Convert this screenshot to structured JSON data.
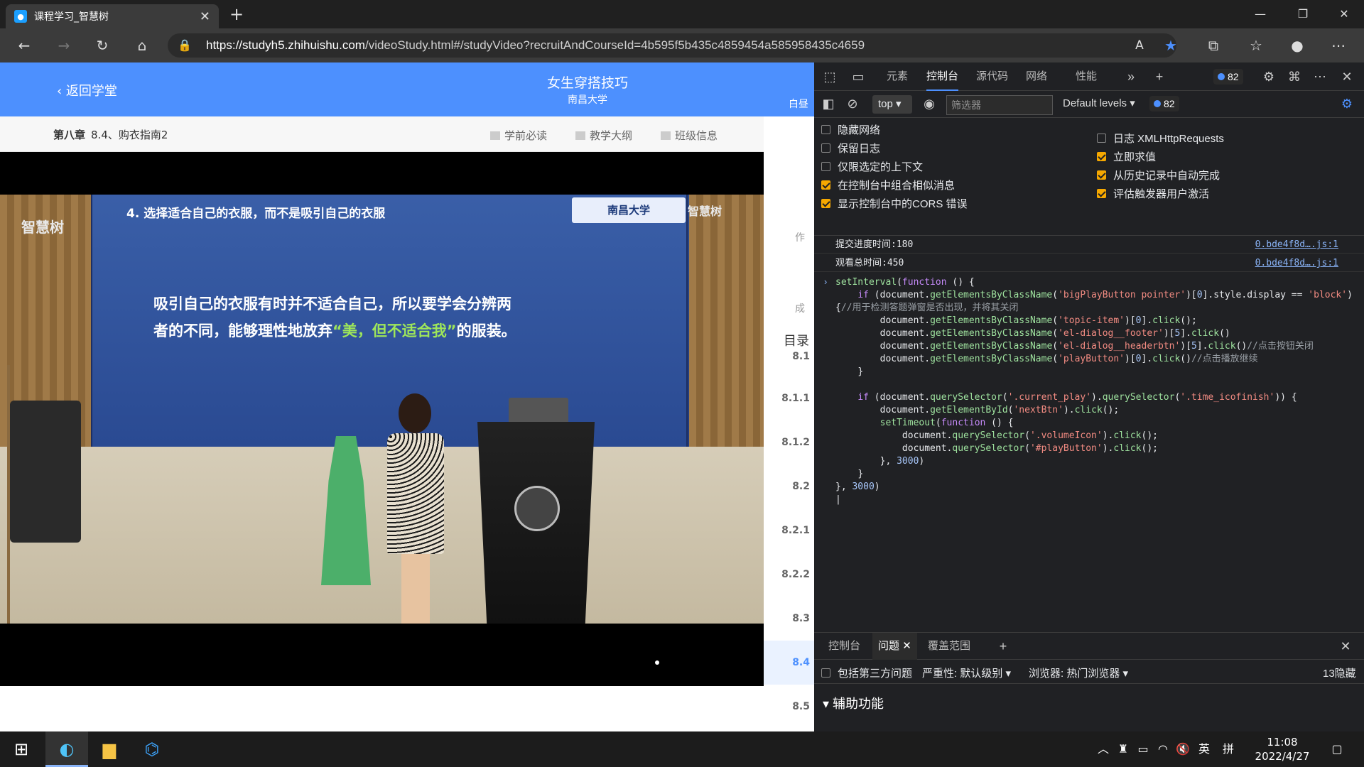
{
  "browser": {
    "tab_title": "课程学习_智慧树",
    "url_host": "https://studyh5.zhihuishu.com",
    "url_path": "/videoStudy.html#/studyVideo?recruitAndCourseId=4b595f5b435c4859454a585958435c4659"
  },
  "page": {
    "back_label": "返回学堂",
    "course_title": "女生穿搭技巧",
    "school": "南昌大学",
    "side_label": "白昼",
    "chapter_bold": "第八章",
    "chapter_title": "8.4、购衣指南2",
    "links": [
      "学前必读",
      "教学大纲",
      "班级信息"
    ],
    "side_icons": [
      "作",
      "成"
    ],
    "toc_title": "目录",
    "toc_items": [
      "8.1",
      "8.1.1",
      "8.1.2",
      "8.2",
      "8.2.1",
      "8.2.2",
      "8.3",
      "8.4",
      "8.5"
    ],
    "toc_active": "8.4"
  },
  "video": {
    "slide_heading": "4. 选择适合自己的衣服，而不是吸引自己的衣服",
    "slide_line1": "吸引自己的衣服有时并不适合自己，所以要学会分辨两",
    "slide_line2_a": "者的不同，能够理性地放弃",
    "slide_line2_b": "“美，但不适合我”",
    "slide_line2_c": "的服装。",
    "watermark": "智慧树",
    "univ_badge": "南昌大学"
  },
  "devtools": {
    "tabs": [
      "元素",
      "控制台",
      "源代码",
      "网络",
      "性能"
    ],
    "active_tab": "控制台",
    "issue_count": "82",
    "context": "top",
    "filter_placeholder": "筛选器",
    "levels": "Default levels",
    "settings_left": [
      {
        "label": "隐藏网络",
        "checked": false
      },
      {
        "label": "保留日志",
        "checked": false
      },
      {
        "label": "仅限选定的上下文",
        "checked": false
      },
      {
        "label": "在控制台中组合相似消息",
        "checked": true
      },
      {
        "label": "显示控制台中的CORS 错误",
        "checked": true
      }
    ],
    "settings_right": [
      {
        "label": "日志 XMLHttpRequests",
        "checked": false
      },
      {
        "label": "立即求值",
        "checked": true
      },
      {
        "label": "从历史记录中自动完成",
        "checked": true
      },
      {
        "label": "评估触发器用户激活",
        "checked": true
      }
    ],
    "logs": [
      {
        "msg": "提交进度时间:180",
        "src": "0.bde4f8d….js:1"
      },
      {
        "msg": "观看总时间:450",
        "src": "0.bde4f8d….js:1"
      }
    ],
    "drawer_tabs": [
      "控制台",
      "问题",
      "覆盖范围"
    ],
    "drawer_active": "问题",
    "drawer_third_party": "包括第三方问题",
    "drawer_severity": "严重性: 默认级别",
    "drawer_browser": "浏览器:  热门浏览器",
    "drawer_hidden": "13隐藏",
    "drawer_section": "辅助功能"
  },
  "taskbar": {
    "time": "11:08",
    "date": "2022/4/27",
    "ime": "英",
    "ime2": "拼"
  }
}
